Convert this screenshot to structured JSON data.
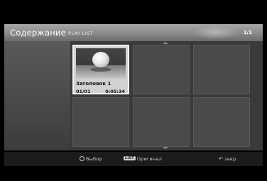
{
  "header": {
    "title": "Содержание",
    "subtitle": "PLAY LIST",
    "pager": "1/1"
  },
  "grid": {
    "items": [
      {
        "title": "Заголовок 1",
        "index": "01/01",
        "duration": "0:05:34"
      }
    ]
  },
  "footer": {
    "select_label": "Выбор",
    "list_key": "LIST",
    "original_label": "Оригинал",
    "close_label": "закр."
  },
  "colors": {
    "background": "#000000",
    "header": "#9a9a9a",
    "panel": "#3a3a3a",
    "selected_tile": "#d2d2d2"
  }
}
